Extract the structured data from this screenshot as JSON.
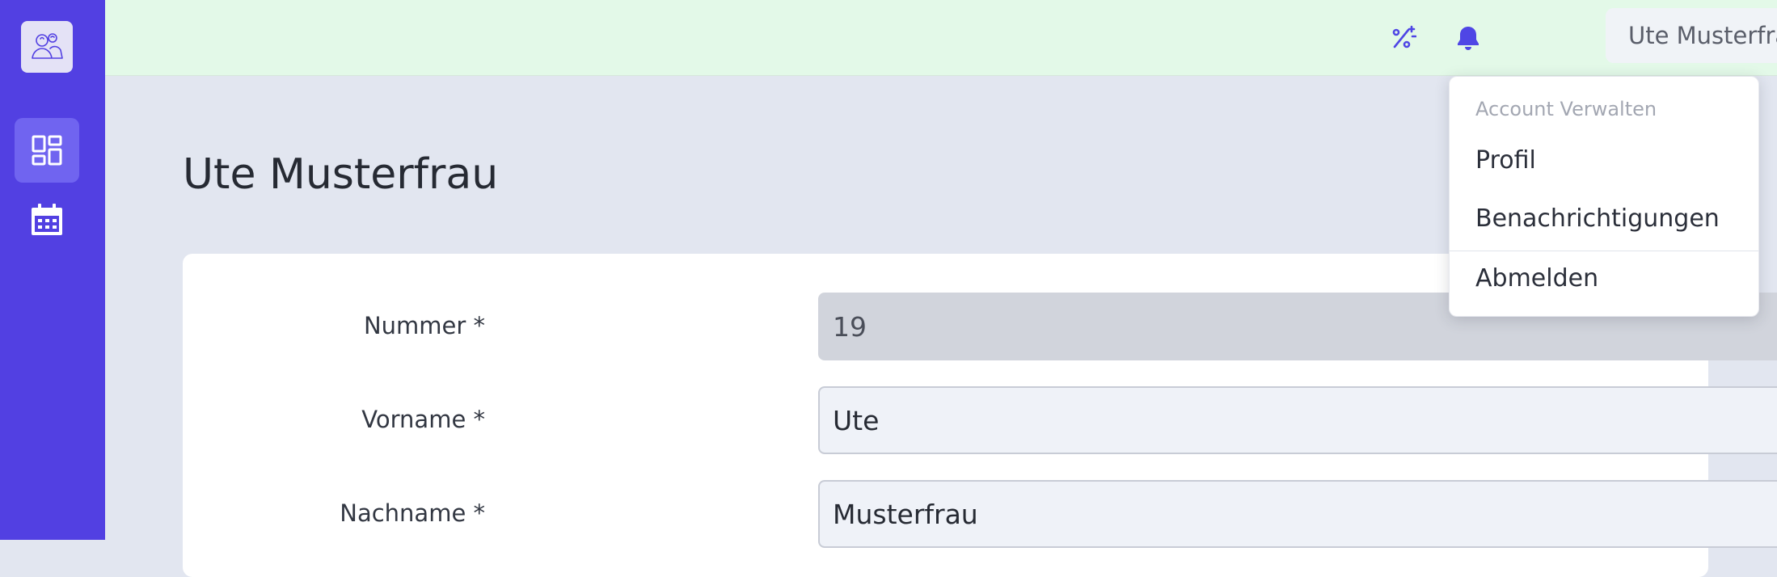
{
  "sidebar": {
    "logo_icon": "user-group-icon",
    "items": [
      {
        "icon": "dashboard-icon",
        "active": true
      },
      {
        "icon": "calendar-icon",
        "active": false
      }
    ],
    "background": "#5240e2",
    "active_background": "#7064f0"
  },
  "topbar": {
    "background": "#e3f9e8",
    "icons": [
      "percent-sparkle-icon",
      "bell-icon"
    ],
    "accent": "#4f46e5",
    "user_name": "Ute Musterfrau"
  },
  "user_menu": {
    "header": "Account Verwalten",
    "items": [
      "Profil",
      "Benachrichtigungen",
      "Abmelden"
    ]
  },
  "page": {
    "title": "Ute Musterfrau"
  },
  "form": {
    "fields": [
      {
        "label": "Nummer *",
        "value": "19",
        "disabled": true
      },
      {
        "label": "Vorname *",
        "value": "Ute",
        "disabled": false
      },
      {
        "label": "Nachname *",
        "value": "Musterfrau",
        "disabled": false
      }
    ]
  }
}
